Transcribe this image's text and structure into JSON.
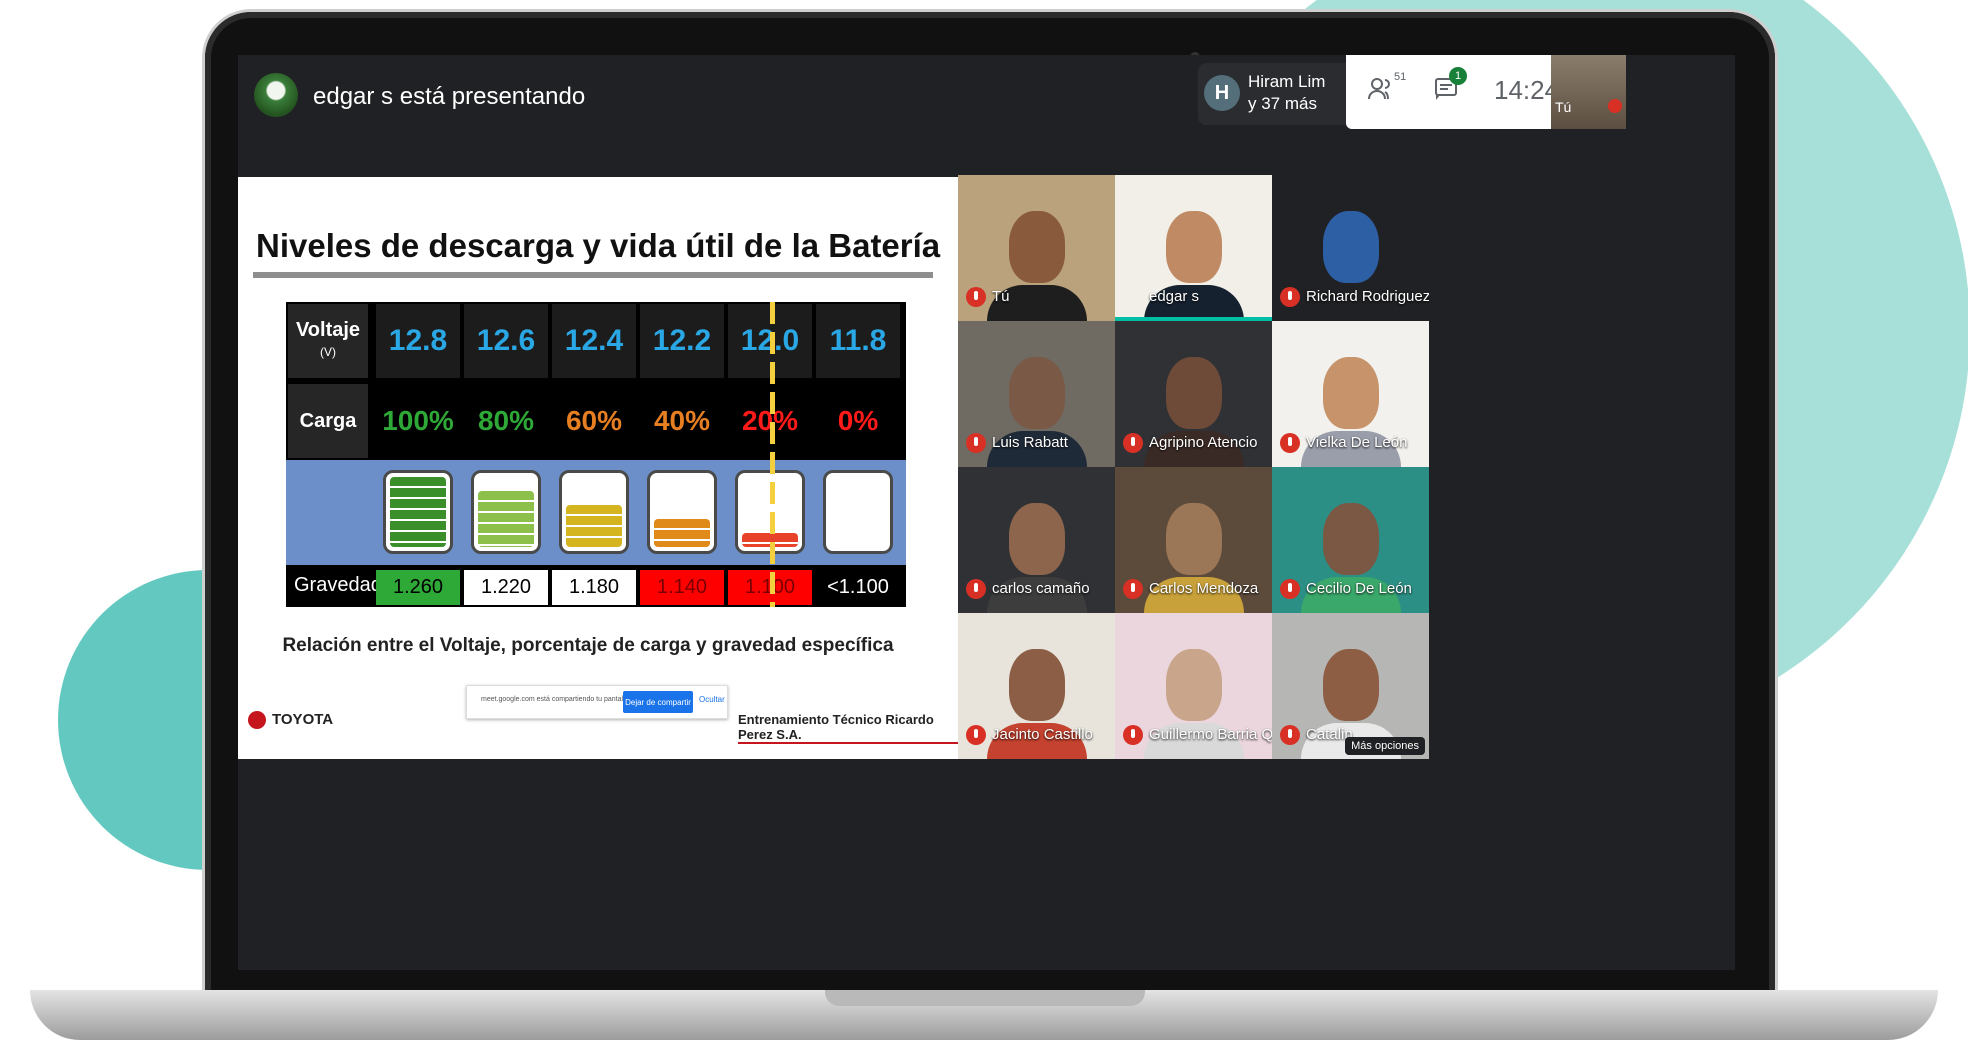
{
  "presenter": {
    "text": "edgar s está presentando"
  },
  "participants_summary": {
    "avatar_letter": "H",
    "line1": "Hiram Lim",
    "line2": "y 37 más"
  },
  "toolbar": {
    "people_count": "51",
    "chat_badge": "1",
    "time": "14:24",
    "self_label": "Tú"
  },
  "slide": {
    "title": "Niveles de descarga y vida útil de la Batería",
    "voltage_header": "Voltaje",
    "voltage_unit": "(V)",
    "carga_header": "Carga",
    "gravedad_header": "Gravedad",
    "columns": [
      {
        "volt": "12.8",
        "carga": "100%",
        "carga_color": "#2ea836",
        "grav": "1.260",
        "grav_bg": "#2ea836",
        "grav_fg": "#000",
        "fill": 1.0,
        "fill_color": "#3b8f2a"
      },
      {
        "volt": "12.6",
        "carga": "80%",
        "carga_color": "#2ea836",
        "grav": "1.220",
        "grav_bg": "#ffffff",
        "grav_fg": "#000",
        "fill": 0.8,
        "fill_color": "#8cc04a"
      },
      {
        "volt": "12.4",
        "carga": "60%",
        "carga_color": "#e67e22",
        "grav": "1.180",
        "grav_bg": "#ffffff",
        "grav_fg": "#000",
        "fill": 0.6,
        "fill_color": "#d4b41f"
      },
      {
        "volt": "12.2",
        "carga": "40%",
        "carga_color": "#e67e22",
        "grav": "1.140",
        "grav_bg": "#ff0000",
        "grav_fg": "#7a0000",
        "fill": 0.4,
        "fill_color": "#e08a1a"
      },
      {
        "volt": "12.0",
        "carga": "20%",
        "carga_color": "#ff1a1a",
        "grav": "1.100",
        "grav_bg": "#ff0000",
        "grav_fg": "#7a0000",
        "fill": 0.2,
        "fill_color": "#e8422a"
      },
      {
        "volt": "11.8",
        "carga": "0%",
        "carga_color": "#ff1a1a",
        "grav": "<1.100",
        "grav_bg": "#000000",
        "grav_fg": "#ffffff",
        "fill": 0.0,
        "fill_color": "#ffffff"
      }
    ],
    "caption": "Relación entre el Voltaje, porcentaje de carga y gravedad específica",
    "brand_left": "TOYOTA",
    "brand_right": "Entrenamiento Técnico Ricardo Perez S.A.",
    "share_bar": {
      "message": "meet.google.com está compartiendo tu pantalla.",
      "stop": "Dejar de compartir",
      "hide": "Ocultar"
    }
  },
  "tiles": [
    {
      "name": "Tú",
      "muted": true,
      "bg": "#b9a27c",
      "face": "#8a5a3c",
      "shirt": "#1e1e1e"
    },
    {
      "name": "edgar s",
      "muted": false,
      "speaking": true,
      "bg": "#f2efe9",
      "face": "#c08b64",
      "shirt": "#16212f"
    },
    {
      "name": "Richard Rodriguez",
      "muted": true,
      "bg": "#202124",
      "face": "#2d5fa5",
      "shirt": "#202124"
    },
    {
      "name": "Luis Rabatt",
      "muted": true,
      "bg": "#6f6a62",
      "face": "#7a5a46",
      "shirt": "#1f2a38"
    },
    {
      "name": "Agripino Atencio",
      "muted": true,
      "bg": "#2f3134",
      "face": "#6e4a38",
      "shirt": "#3a2a25"
    },
    {
      "name": "Vielka De León",
      "muted": true,
      "bg": "#f3f1ed",
      "face": "#c6936a",
      "shirt": "#9a9eaa"
    },
    {
      "name": "carlos camaño",
      "muted": true,
      "bg": "#2f3134",
      "face": "#8d654d",
      "shirt": "#3d3d3d"
    },
    {
      "name": "Carlos Mendoza",
      "muted": true,
      "bg": "#5c4a3a",
      "face": "#9b7757",
      "shirt": "#c9a13a"
    },
    {
      "name": "Cecilio De León",
      "muted": true,
      "bg": "#2c8f85",
      "face": "#7a5844",
      "shirt": "#3aa86a"
    },
    {
      "name": "Jacinto Castillo",
      "muted": true,
      "bg": "#e8e4dc",
      "face": "#8c5e45",
      "shirt": "#c4422f"
    },
    {
      "name": "Guillermo Barria Qui...",
      "muted": true,
      "bg": "#ead6dc",
      "face": "#c9a58c",
      "shirt": "#d9d9d9"
    },
    {
      "name": "Catalin",
      "muted": true,
      "bg": "#b6b7b4",
      "face": "#8e5e44",
      "shirt": "#e9e9e9"
    }
  ],
  "more_options_label": "Más opciones"
}
